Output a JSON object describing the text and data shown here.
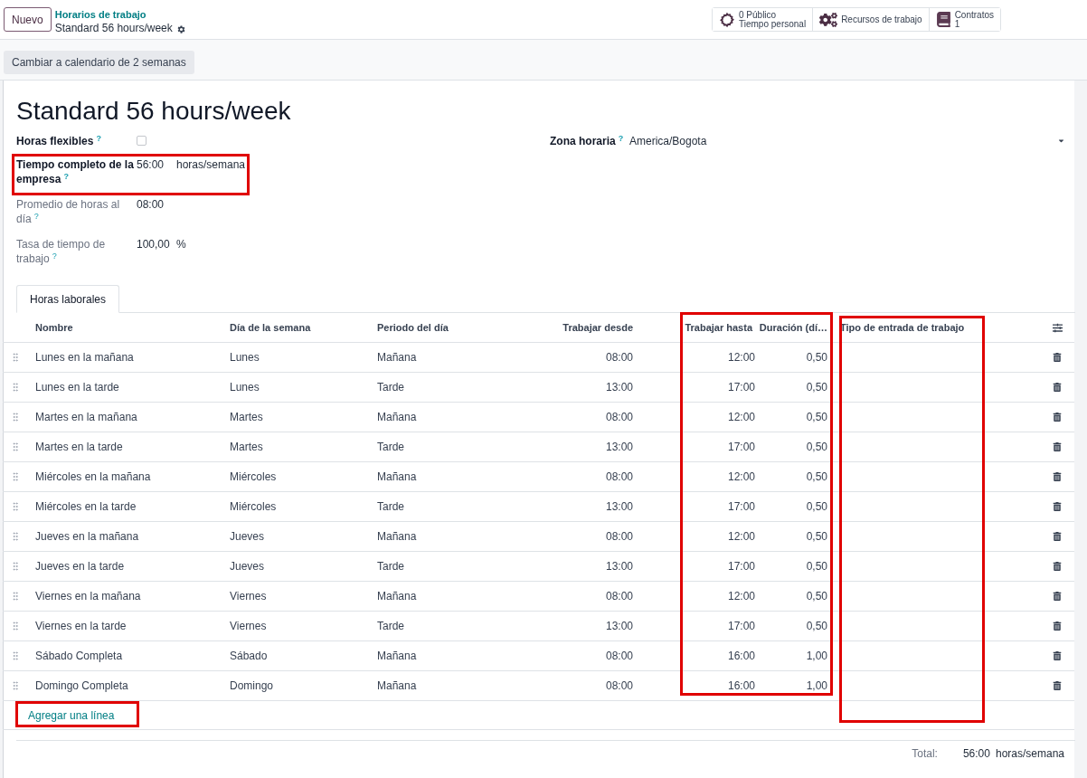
{
  "header": {
    "new_button": "Nuevo",
    "breadcrumb": "Horarios de trabajo",
    "record": "Standard 56 hours/week"
  },
  "stat_buttons": [
    {
      "kind": "time",
      "lines": [
        "0 Público",
        "Tiempo personal"
      ]
    },
    {
      "kind": "resources",
      "lines": [
        "Recursos de trabajo"
      ]
    },
    {
      "kind": "contracts",
      "lines": [
        "Contratos",
        "1"
      ]
    }
  ],
  "toolbar": {
    "button": "Cambiar a calendario de 2 semanas"
  },
  "form": {
    "title": "Standard 56 hours/week",
    "left_fields": [
      {
        "kind": "checkbox",
        "label": "Horas flexibles",
        "bold": true,
        "help": "?",
        "checked": false
      },
      {
        "kind": "value",
        "label": "Tiempo completo de la empresa",
        "bold": true,
        "help": "?",
        "value": "56:00",
        "unit": "horas/semana"
      },
      {
        "kind": "value",
        "label": "Promedio de horas al día",
        "bold": false,
        "help": "?",
        "value": "08:00"
      },
      {
        "kind": "value",
        "label": "Tasa de tiempo de trabajo",
        "bold": false,
        "help": "?",
        "value": "100,00",
        "unit": "%"
      }
    ],
    "timezone": {
      "label": "Zona horaria",
      "help": "?",
      "value": "America/Bogota"
    }
  },
  "tabs": [
    {
      "label": "Horas laborales",
      "selected": true
    }
  ],
  "table": {
    "columns": [
      "Nombre",
      "Día de la semana",
      "Periodo del día",
      "Trabajar desde",
      "Trabajar hasta",
      "Duración (dí…",
      "Tipo de entrada de trabajo"
    ],
    "rows": [
      [
        "Lunes en la mañana",
        "Lunes",
        "Mañana",
        "08:00",
        "12:00",
        "0,50"
      ],
      [
        "Lunes en la tarde",
        "Lunes",
        "Tarde",
        "13:00",
        "17:00",
        "0,50"
      ],
      [
        "Martes en la mañana",
        "Martes",
        "Mañana",
        "08:00",
        "12:00",
        "0,50"
      ],
      [
        "Martes en la tarde",
        "Martes",
        "Tarde",
        "13:00",
        "17:00",
        "0,50"
      ],
      [
        "Miércoles en la mañana",
        "Miércoles",
        "Mañana",
        "08:00",
        "12:00",
        "0,50"
      ],
      [
        "Miércoles en la tarde",
        "Miércoles",
        "Tarde",
        "13:00",
        "17:00",
        "0,50"
      ],
      [
        "Jueves en la mañana",
        "Jueves",
        "Mañana",
        "08:00",
        "12:00",
        "0,50"
      ],
      [
        "Jueves en la tarde",
        "Jueves",
        "Tarde",
        "13:00",
        "17:00",
        "0,50"
      ],
      [
        "Viernes en la mañana",
        "Viernes",
        "Mañana",
        "08:00",
        "12:00",
        "0,50"
      ],
      [
        "Viernes en la tarde",
        "Viernes",
        "Tarde",
        "13:00",
        "17:00",
        "0,50"
      ],
      [
        "Sábado Completa",
        "Sábado",
        "Mañana",
        "08:00",
        "16:00",
        "1,00"
      ],
      [
        "Domingo Completa",
        "Domingo",
        "Mañana",
        "08:00",
        "16:00",
        "1,00"
      ]
    ],
    "add_line": "Agregar una línea",
    "total": {
      "label": "Total:",
      "value": "56:00",
      "unit": "horas/semana"
    }
  }
}
